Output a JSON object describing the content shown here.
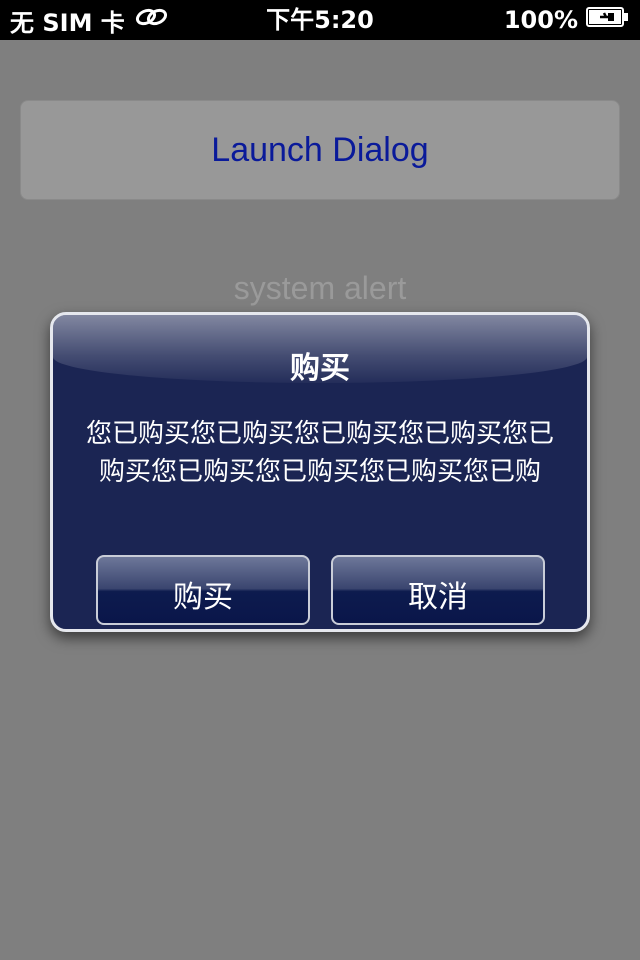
{
  "status_bar": {
    "carrier": "无 SIM 卡",
    "activity_icon": "activity-icon",
    "time": "下午5:20",
    "battery_percent": "100%",
    "battery_icon": "battery-charging-icon"
  },
  "main": {
    "launch_button_label": "Launch Dialog",
    "system_alert_label": "system alert"
  },
  "alert": {
    "title": "购买",
    "message": "您已购买您已购买您已购买您已购买您已购买您已购买您已购买您已购买您已购",
    "buy_label": "购买",
    "cancel_label": "取消"
  },
  "colors": {
    "background": "#7f7f7f",
    "alert_background": "#1b2553",
    "launch_text": "#0a1a9a"
  }
}
